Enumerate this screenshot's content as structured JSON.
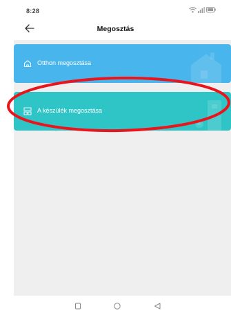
{
  "status": {
    "time": "8:28"
  },
  "header": {
    "title": "Megosztás"
  },
  "cards": [
    {
      "label": "Otthon megosztása",
      "icon": "home-icon",
      "color": "#48b5ec"
    },
    {
      "label": "A készülék megosztása",
      "icon": "device-grid-icon",
      "color": "#2fc4c6"
    }
  ],
  "annotation": {
    "color": "#e8151d",
    "shape": "ellipse"
  },
  "nav": {
    "buttons": [
      "recents-square-icon",
      "home-circle-icon",
      "back-triangle-icon"
    ]
  }
}
